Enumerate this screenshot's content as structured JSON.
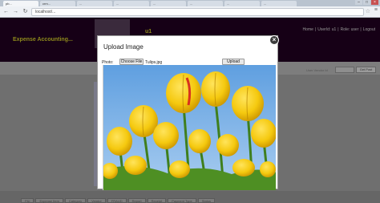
{
  "browser": {
    "tabs": [
      {
        "label": "pb..."
      },
      {
        "label": "crm..."
      },
      {
        "label": "..."
      },
      {
        "label": "..."
      },
      {
        "label": "..."
      },
      {
        "label": "..."
      },
      {
        "label": "..."
      },
      {
        "label": "..."
      }
    ],
    "address": "localhost/...",
    "icons": [
      "back-icon",
      "forward-icon",
      "reload-icon",
      "star-icon",
      "menu-icon"
    ]
  },
  "app": {
    "title": "Expense Accounting...",
    "user": "u1",
    "links": [
      "Home",
      "|",
      "UserId: u1",
      "|",
      "Role: user",
      "|",
      "Logout"
    ],
    "search_label": "User Vendor Id",
    "go_label": "Get Post",
    "nav_tabs": [
      "P&I",
      "Expense Item",
      "Category",
      "Vendor",
      "FRAUD",
      "Report",
      "Receipt",
      "Payment Type",
      "Status"
    ]
  },
  "modal": {
    "title": "Upload Image",
    "photo_label": "Photo:",
    "choose_file_label": "Choose File",
    "file_name": "Tulips.jpg",
    "upload_label": "Upload"
  },
  "colors": {
    "header_bg": "#160016",
    "title_color": "#8e8a1c",
    "overlay": "#6f6f6f",
    "tulip_yellow": "#f5c90f",
    "sky": "#6fa8dc"
  }
}
